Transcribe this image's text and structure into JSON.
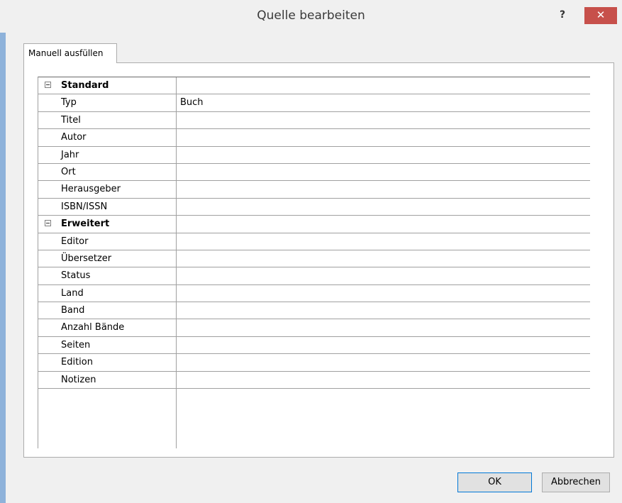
{
  "window": {
    "title": "Quelle bearbeiten",
    "help_glyph": "?",
    "close_glyph": "✕"
  },
  "tab": {
    "label": "Manuell ausfüllen"
  },
  "grid": {
    "categories": [
      {
        "label": "Standard",
        "rows": [
          {
            "name": "Typ",
            "value": "Buch"
          },
          {
            "name": "Titel",
            "value": ""
          },
          {
            "name": "Autor",
            "value": ""
          },
          {
            "name": "Jahr",
            "value": ""
          },
          {
            "name": "Ort",
            "value": ""
          },
          {
            "name": "Herausgeber",
            "value": ""
          },
          {
            "name": "ISBN/ISSN",
            "value": ""
          }
        ]
      },
      {
        "label": "Erweitert",
        "rows": [
          {
            "name": "Editor",
            "value": ""
          },
          {
            "name": "Übersetzer",
            "value": ""
          },
          {
            "name": "Status",
            "value": ""
          },
          {
            "name": "Land",
            "value": ""
          },
          {
            "name": "Band",
            "value": ""
          },
          {
            "name": "Anzahl Bände",
            "value": ""
          },
          {
            "name": "Seiten",
            "value": ""
          },
          {
            "name": "Edition",
            "value": ""
          },
          {
            "name": "Notizen",
            "value": ""
          }
        ]
      }
    ]
  },
  "buttons": {
    "ok": "OK",
    "cancel": "Abbrechen"
  }
}
